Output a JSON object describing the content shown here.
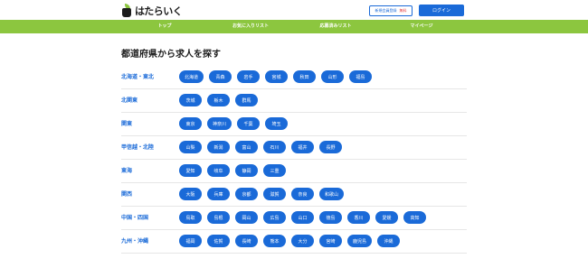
{
  "header": {
    "logo_text": "はたらいく",
    "member_label": "新規会員登録",
    "member_free": "無料",
    "login_label": "ログイン"
  },
  "nav": {
    "items": [
      {
        "label": "トップ"
      },
      {
        "label": "お気に入りリスト"
      },
      {
        "label": "応募済みリスト"
      },
      {
        "label": "マイページ"
      }
    ]
  },
  "main": {
    "title": "都道府県から求人を探す",
    "regions": [
      {
        "name": "北海道・東北",
        "prefectures": [
          "北海道",
          "青森",
          "岩手",
          "宮城",
          "秋田",
          "山形",
          "福島"
        ]
      },
      {
        "name": "北関東",
        "prefectures": [
          "茨城",
          "栃木",
          "群馬"
        ]
      },
      {
        "name": "関東",
        "prefectures": [
          "東京",
          "神奈川",
          "千葉",
          "埼玉"
        ]
      },
      {
        "name": "甲信越・北陸",
        "prefectures": [
          "山梨",
          "新潟",
          "富山",
          "石川",
          "福井",
          "長野"
        ]
      },
      {
        "name": "東海",
        "prefectures": [
          "愛知",
          "岐阜",
          "静岡",
          "三重"
        ]
      },
      {
        "name": "関西",
        "prefectures": [
          "大阪",
          "兵庫",
          "京都",
          "滋賀",
          "奈良",
          "和歌山"
        ]
      },
      {
        "name": "中国・四国",
        "prefectures": [
          "鳥取",
          "島根",
          "岡山",
          "広島",
          "山口",
          "徳島",
          "香川",
          "愛媛",
          "高知"
        ]
      },
      {
        "name": "九州・沖縄",
        "prefectures": [
          "福岡",
          "佐賀",
          "長崎",
          "熊本",
          "大分",
          "宮崎",
          "鹿児島",
          "沖縄"
        ]
      }
    ]
  },
  "colors": {
    "accent_blue": "#1a6ad8",
    "nav_green": "#8cc63f",
    "free_red": "#e3393c"
  }
}
